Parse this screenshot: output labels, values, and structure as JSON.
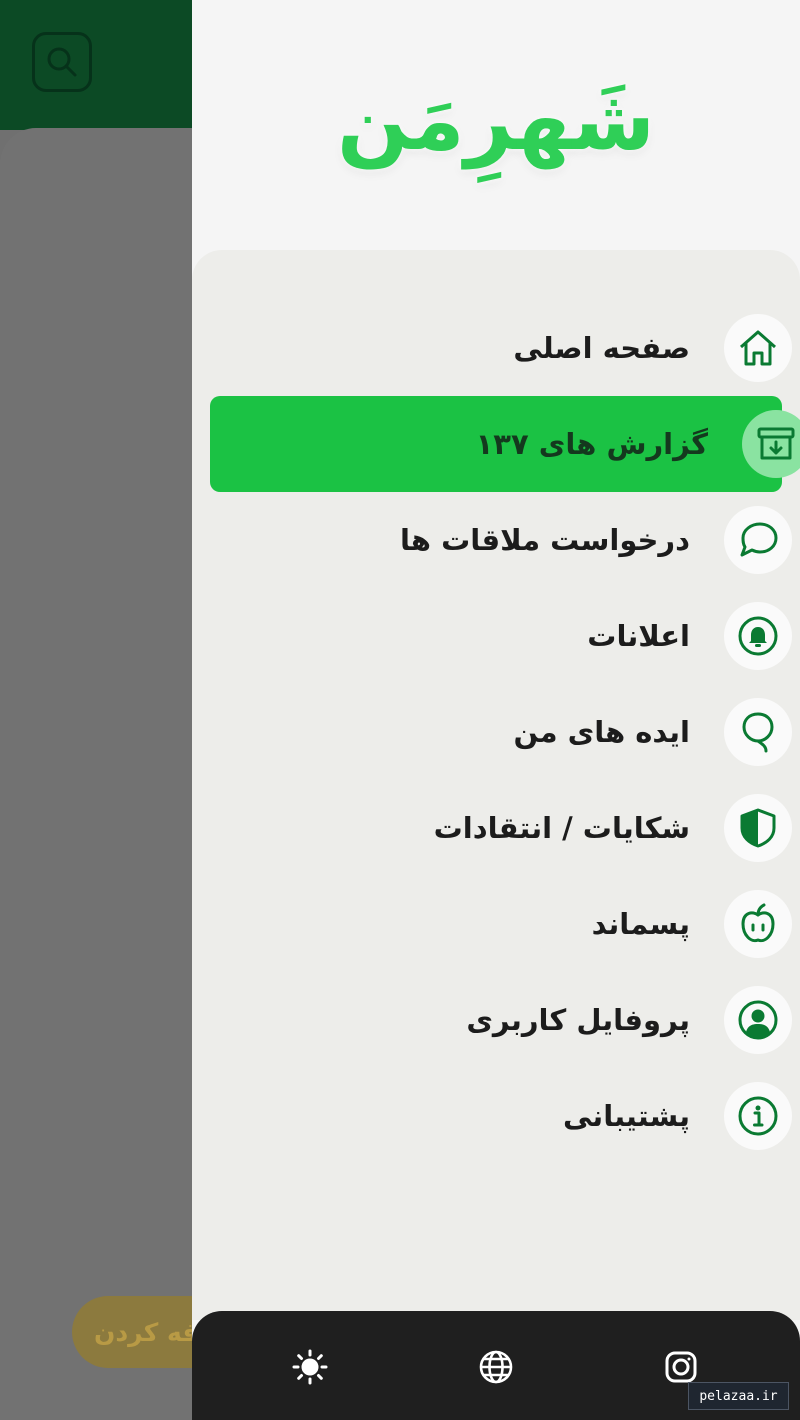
{
  "background": {
    "add_button_label": "اضافه کردن"
  },
  "drawer": {
    "logo": "شَهرِمَن",
    "menu": [
      {
        "label": "صفحه اصلی",
        "icon": "home-icon",
        "active": false
      },
      {
        "label": "گزارش های ۱۳۷",
        "icon": "archive-download-icon",
        "active": true
      },
      {
        "label": "درخواست ملاقات ها",
        "icon": "chat-bubble-icon",
        "active": false
      },
      {
        "label": "اعلانات",
        "icon": "bell-icon",
        "active": false
      },
      {
        "label": "ایده های من",
        "icon": "balloon-icon",
        "active": false
      },
      {
        "label": "شکایات / انتقادات",
        "icon": "shield-icon",
        "active": false
      },
      {
        "label": "پسماند",
        "icon": "apple-icon",
        "active": false
      },
      {
        "label": "پروفایل کاربری",
        "icon": "user-circle-icon",
        "active": false
      },
      {
        "label": "پشتیبانی",
        "icon": "info-icon",
        "active": false
      }
    ],
    "bottom_bar": [
      "theme-sun-icon",
      "language-globe-icon",
      "instagram-icon"
    ]
  },
  "watermark": "pelazaa.ir",
  "colors": {
    "accent_green": "#1bc244",
    "icon_green": "#0a7a32",
    "header_green": "#0c4a25",
    "bottom_bar": "#1f1f1f"
  }
}
